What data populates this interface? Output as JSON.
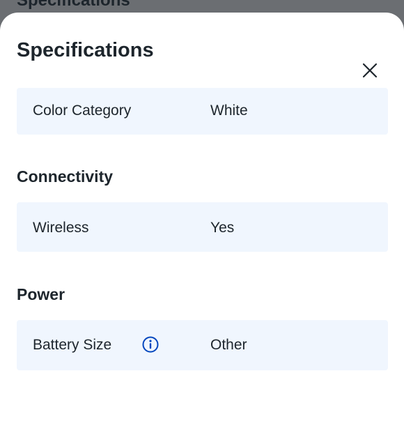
{
  "backdrop": {
    "title": "Specifications"
  },
  "sheet": {
    "title": "Specifications",
    "close_icon": "close-icon"
  },
  "sections": [
    {
      "heading": "",
      "rows": [
        {
          "label": "Color Category",
          "value": "White"
        }
      ]
    },
    {
      "heading": "Connectivity",
      "rows": [
        {
          "label": "Wireless",
          "value": "Yes"
        }
      ]
    },
    {
      "heading": "Power",
      "rows": [
        {
          "label": "Battery Size",
          "value": "Other",
          "info_icon": "info-icon"
        }
      ]
    }
  ],
  "colors": {
    "overlay": "#6b6e72",
    "row_background": "#f0f6fe",
    "text": "#1d252c",
    "info_icon": "#0046be"
  }
}
